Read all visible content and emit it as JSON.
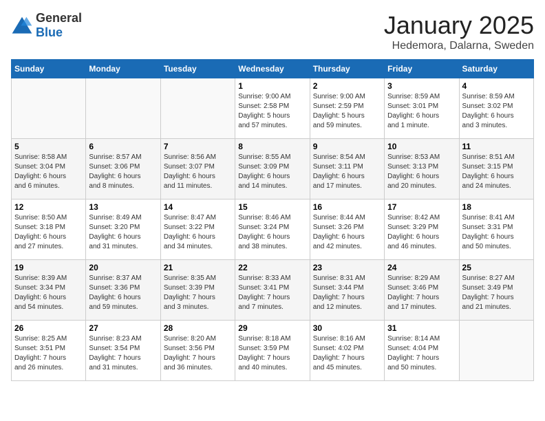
{
  "header": {
    "logo_general": "General",
    "logo_blue": "Blue",
    "month_year": "January 2025",
    "location": "Hedemora, Dalarna, Sweden"
  },
  "calendar": {
    "days_of_week": [
      "Sunday",
      "Monday",
      "Tuesday",
      "Wednesday",
      "Thursday",
      "Friday",
      "Saturday"
    ],
    "weeks": [
      [
        {
          "day": "",
          "info": ""
        },
        {
          "day": "",
          "info": ""
        },
        {
          "day": "",
          "info": ""
        },
        {
          "day": "1",
          "info": "Sunrise: 9:00 AM\nSunset: 2:58 PM\nDaylight: 5 hours\nand 57 minutes."
        },
        {
          "day": "2",
          "info": "Sunrise: 9:00 AM\nSunset: 2:59 PM\nDaylight: 5 hours\nand 59 minutes."
        },
        {
          "day": "3",
          "info": "Sunrise: 8:59 AM\nSunset: 3:01 PM\nDaylight: 6 hours\nand 1 minute."
        },
        {
          "day": "4",
          "info": "Sunrise: 8:59 AM\nSunset: 3:02 PM\nDaylight: 6 hours\nand 3 minutes."
        }
      ],
      [
        {
          "day": "5",
          "info": "Sunrise: 8:58 AM\nSunset: 3:04 PM\nDaylight: 6 hours\nand 6 minutes."
        },
        {
          "day": "6",
          "info": "Sunrise: 8:57 AM\nSunset: 3:06 PM\nDaylight: 6 hours\nand 8 minutes."
        },
        {
          "day": "7",
          "info": "Sunrise: 8:56 AM\nSunset: 3:07 PM\nDaylight: 6 hours\nand 11 minutes."
        },
        {
          "day": "8",
          "info": "Sunrise: 8:55 AM\nSunset: 3:09 PM\nDaylight: 6 hours\nand 14 minutes."
        },
        {
          "day": "9",
          "info": "Sunrise: 8:54 AM\nSunset: 3:11 PM\nDaylight: 6 hours\nand 17 minutes."
        },
        {
          "day": "10",
          "info": "Sunrise: 8:53 AM\nSunset: 3:13 PM\nDaylight: 6 hours\nand 20 minutes."
        },
        {
          "day": "11",
          "info": "Sunrise: 8:51 AM\nSunset: 3:15 PM\nDaylight: 6 hours\nand 24 minutes."
        }
      ],
      [
        {
          "day": "12",
          "info": "Sunrise: 8:50 AM\nSunset: 3:18 PM\nDaylight: 6 hours\nand 27 minutes."
        },
        {
          "day": "13",
          "info": "Sunrise: 8:49 AM\nSunset: 3:20 PM\nDaylight: 6 hours\nand 31 minutes."
        },
        {
          "day": "14",
          "info": "Sunrise: 8:47 AM\nSunset: 3:22 PM\nDaylight: 6 hours\nand 34 minutes."
        },
        {
          "day": "15",
          "info": "Sunrise: 8:46 AM\nSunset: 3:24 PM\nDaylight: 6 hours\nand 38 minutes."
        },
        {
          "day": "16",
          "info": "Sunrise: 8:44 AM\nSunset: 3:26 PM\nDaylight: 6 hours\nand 42 minutes."
        },
        {
          "day": "17",
          "info": "Sunrise: 8:42 AM\nSunset: 3:29 PM\nDaylight: 6 hours\nand 46 minutes."
        },
        {
          "day": "18",
          "info": "Sunrise: 8:41 AM\nSunset: 3:31 PM\nDaylight: 6 hours\nand 50 minutes."
        }
      ],
      [
        {
          "day": "19",
          "info": "Sunrise: 8:39 AM\nSunset: 3:34 PM\nDaylight: 6 hours\nand 54 minutes."
        },
        {
          "day": "20",
          "info": "Sunrise: 8:37 AM\nSunset: 3:36 PM\nDaylight: 6 hours\nand 59 minutes."
        },
        {
          "day": "21",
          "info": "Sunrise: 8:35 AM\nSunset: 3:39 PM\nDaylight: 7 hours\nand 3 minutes."
        },
        {
          "day": "22",
          "info": "Sunrise: 8:33 AM\nSunset: 3:41 PM\nDaylight: 7 hours\nand 7 minutes."
        },
        {
          "day": "23",
          "info": "Sunrise: 8:31 AM\nSunset: 3:44 PM\nDaylight: 7 hours\nand 12 minutes."
        },
        {
          "day": "24",
          "info": "Sunrise: 8:29 AM\nSunset: 3:46 PM\nDaylight: 7 hours\nand 17 minutes."
        },
        {
          "day": "25",
          "info": "Sunrise: 8:27 AM\nSunset: 3:49 PM\nDaylight: 7 hours\nand 21 minutes."
        }
      ],
      [
        {
          "day": "26",
          "info": "Sunrise: 8:25 AM\nSunset: 3:51 PM\nDaylight: 7 hours\nand 26 minutes."
        },
        {
          "day": "27",
          "info": "Sunrise: 8:23 AM\nSunset: 3:54 PM\nDaylight: 7 hours\nand 31 minutes."
        },
        {
          "day": "28",
          "info": "Sunrise: 8:20 AM\nSunset: 3:56 PM\nDaylight: 7 hours\nand 36 minutes."
        },
        {
          "day": "29",
          "info": "Sunrise: 8:18 AM\nSunset: 3:59 PM\nDaylight: 7 hours\nand 40 minutes."
        },
        {
          "day": "30",
          "info": "Sunrise: 8:16 AM\nSunset: 4:02 PM\nDaylight: 7 hours\nand 45 minutes."
        },
        {
          "day": "31",
          "info": "Sunrise: 8:14 AM\nSunset: 4:04 PM\nDaylight: 7 hours\nand 50 minutes."
        },
        {
          "day": "",
          "info": ""
        }
      ]
    ]
  }
}
